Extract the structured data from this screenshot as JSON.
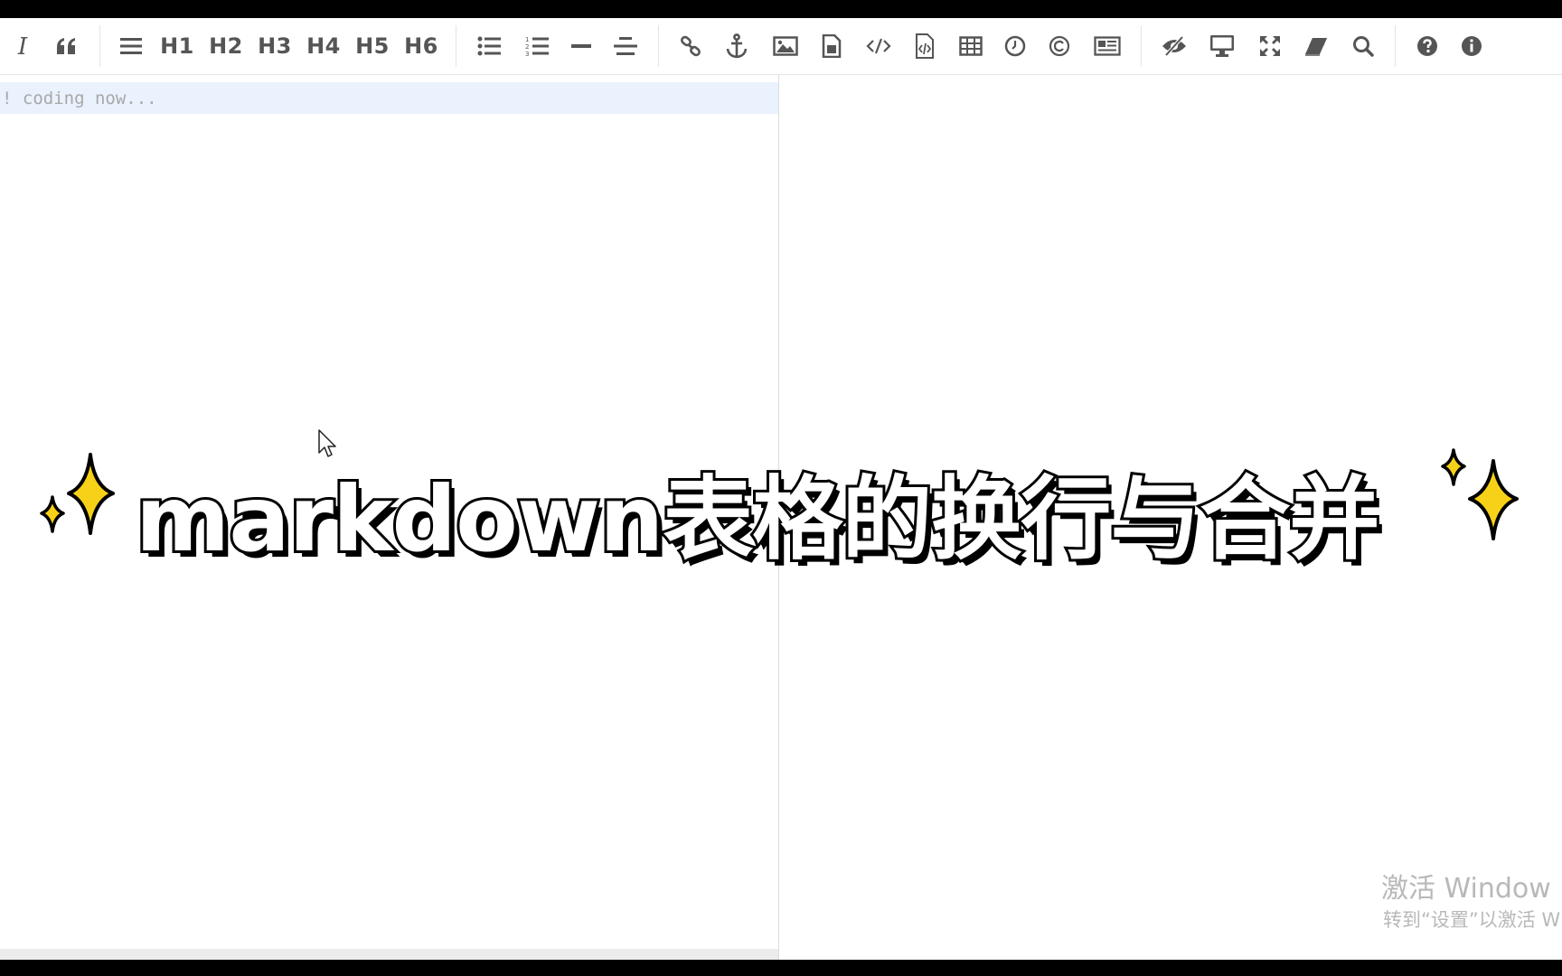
{
  "toolbar": {
    "headings": [
      "H1",
      "H2",
      "H3",
      "H4",
      "H5",
      "H6"
    ]
  },
  "editor": {
    "line_1": "! coding now..."
  },
  "overlay": {
    "title": "markdown表格的换行与合并"
  },
  "watermark": {
    "line_1": "激活 Window",
    "line_2": "转到“设置”以激活 W"
  },
  "colors": {
    "toolbar_icon": "#555555",
    "active_line": "#e9f2fd",
    "sparkle": "#f7d117",
    "title_fill": "#ffffff",
    "title_outline": "#000000"
  }
}
